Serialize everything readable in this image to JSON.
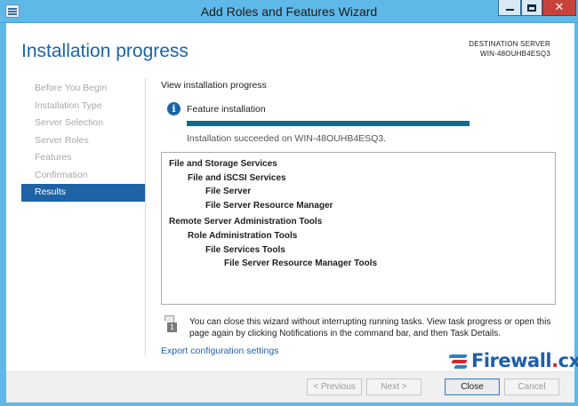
{
  "window": {
    "title": "Add Roles and Features Wizard",
    "controls": {
      "minimize": "minimize",
      "maximize": "maximize",
      "close": "✕"
    }
  },
  "header": {
    "title": "Installation progress",
    "destination_label": "DESTINATION SERVER",
    "destination_value": "WIN-48OUHB4ESQ3"
  },
  "sidebar": {
    "items": [
      {
        "label": "Before You Begin",
        "active": false
      },
      {
        "label": "Installation Type",
        "active": false
      },
      {
        "label": "Server Selection",
        "active": false
      },
      {
        "label": "Server Roles",
        "active": false
      },
      {
        "label": "Features",
        "active": false
      },
      {
        "label": "Confirmation",
        "active": false
      },
      {
        "label": "Results",
        "active": true
      }
    ]
  },
  "main": {
    "heading": "View installation progress",
    "feature_label": "Feature installation",
    "progress": {
      "value": 1.0
    },
    "status": "Installation succeeded on WIN-48OUHB4ESQ3.",
    "results": [
      {
        "text": "File and Storage Services",
        "level": 0
      },
      {
        "text": "File and iSCSI Services",
        "level": 1
      },
      {
        "text": "File Server",
        "level": 2
      },
      {
        "text": "File Server Resource Manager",
        "level": 2
      },
      {
        "text": "Remote Server Administration Tools",
        "level": 0
      },
      {
        "text": "Role Administration Tools",
        "level": 1
      },
      {
        "text": "File Services Tools",
        "level": 2
      },
      {
        "text": "File Server Resource Manager Tools",
        "level": 3
      }
    ],
    "note_badge": "1",
    "note": "You can close this wizard without interrupting running tasks. View task progress or open this page again by clicking Notifications in the command bar, and then Task Details.",
    "export_link": "Export configuration settings"
  },
  "watermark": {
    "name": "Firewall",
    "dot": ".",
    "tld": "cx"
  },
  "footer": {
    "previous": "< Previous",
    "next": "Next >",
    "close": "Close",
    "cancel": "Cancel"
  },
  "colors": {
    "titlebar": "#5fb9e8",
    "accent": "#1e63a6",
    "progress": "#0b6d88",
    "close_button": "#c7433a"
  }
}
